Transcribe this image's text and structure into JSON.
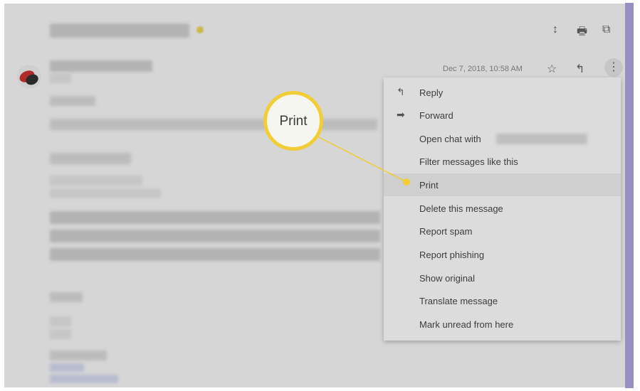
{
  "header": {
    "icons": [
      "expand-icon",
      "print-icon",
      "open-in-new-window-icon"
    ]
  },
  "message": {
    "date": "Dec 7, 2018, 10:58 AM",
    "icons": [
      "star-icon",
      "reply-icon",
      "more-vert-icon"
    ]
  },
  "callout": {
    "label": "Print",
    "color": "#f2cd36"
  },
  "menu": {
    "items": [
      {
        "label": "Reply",
        "icon": "reply-icon"
      },
      {
        "label": "Forward",
        "icon": "forward-icon"
      },
      {
        "label": "Open chat with"
      },
      {
        "label": "Filter messages like this"
      },
      {
        "label": "Print"
      },
      {
        "label": "Delete this message"
      },
      {
        "label": "Report spam"
      },
      {
        "label": "Report phishing"
      },
      {
        "label": "Show original"
      },
      {
        "label": "Translate message"
      },
      {
        "label": "Mark unread from here"
      }
    ]
  },
  "colors": {
    "scrollbar": "#9990c2",
    "highlight": "#f2cd36"
  }
}
